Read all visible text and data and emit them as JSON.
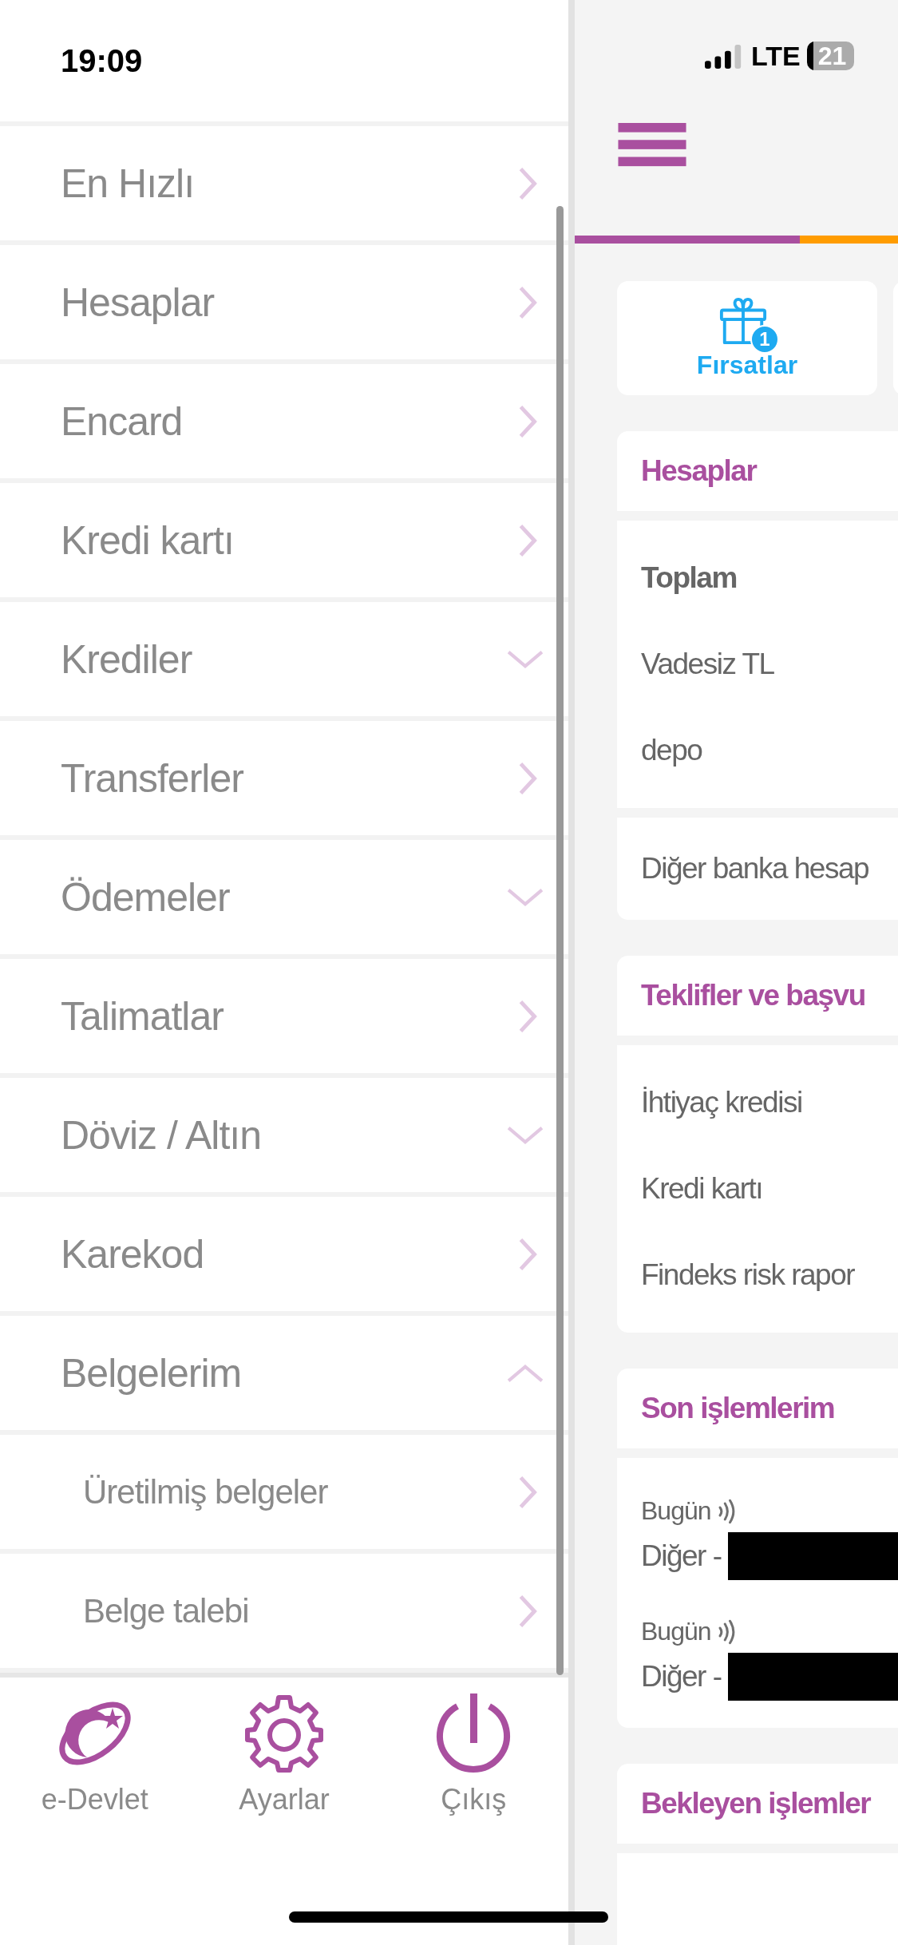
{
  "status_bar": {
    "time": "19:09",
    "network": "LTE",
    "battery": "21"
  },
  "menu": {
    "items": [
      {
        "label": "En Hızlı",
        "kind": "link"
      },
      {
        "label": "Hesaplar",
        "kind": "link"
      },
      {
        "label": "Encard",
        "kind": "link"
      },
      {
        "label": "Kredi kartı",
        "kind": "link"
      },
      {
        "label": "Krediler",
        "kind": "group",
        "expanded": false
      },
      {
        "label": "Transferler",
        "kind": "link"
      },
      {
        "label": "Ödemeler",
        "kind": "group",
        "expanded": false
      },
      {
        "label": "Talimatlar",
        "kind": "link"
      },
      {
        "label": "Döviz / Altın",
        "kind": "group",
        "expanded": false
      },
      {
        "label": "Karekod",
        "kind": "link"
      },
      {
        "label": "Belgelerim",
        "kind": "group",
        "expanded": true,
        "children": [
          {
            "label": "Üretilmiş belgeler",
            "kind": "link"
          },
          {
            "label": "Belge talebi",
            "kind": "link"
          }
        ]
      }
    ]
  },
  "bottom_bar": [
    {
      "label": "e-Devlet"
    },
    {
      "label": "Ayarlar"
    },
    {
      "label": "Çıkış"
    }
  ],
  "main": {
    "tiles": [
      {
        "label": "Fırsatlar",
        "badge": "1"
      }
    ],
    "sections": [
      {
        "title": "Hesaplar",
        "blocks": [
          [
            {
              "kind": "total",
              "text": "Toplam"
            },
            {
              "kind": "plain",
              "text": "Vadesiz TL"
            },
            {
              "kind": "plain",
              "text": "depo"
            }
          ],
          [
            {
              "kind": "plain",
              "text": "Diğer banka hesap"
            }
          ]
        ]
      },
      {
        "title": "Teklifler ve başvu",
        "blocks": [
          [
            {
              "kind": "plain",
              "text": "İhtiyaç kredisi"
            },
            {
              "kind": "plain",
              "text": "Kredi kartı"
            },
            {
              "kind": "plain",
              "text": "Findeks risk rapor"
            }
          ]
        ]
      },
      {
        "title": "Son işlemlerim",
        "blocks": [
          [
            {
              "kind": "transaction",
              "date": "Bugün",
              "text": "Diğer -",
              "redacted": true
            },
            {
              "kind": "transaction",
              "date": "Bugün",
              "text": "Diğer -",
              "redacted": true
            }
          ]
        ]
      },
      {
        "title": "Bekleyen işlemler"
      }
    ]
  }
}
